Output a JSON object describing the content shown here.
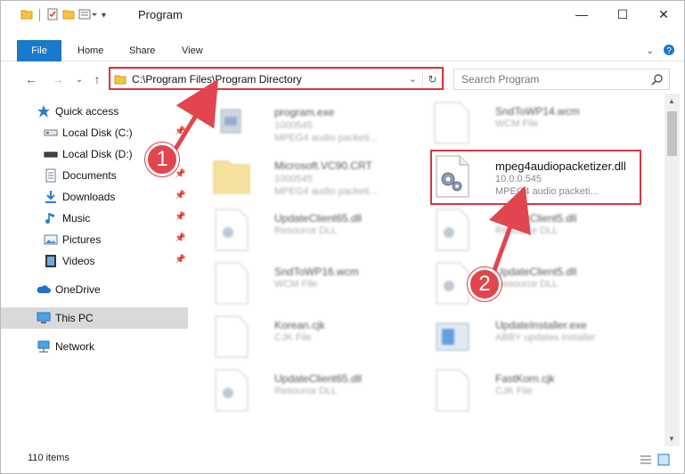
{
  "window": {
    "title": "Program",
    "controls": {
      "minimize": "—",
      "maximize": "☐",
      "close": "✕"
    }
  },
  "ribbon": {
    "file": "File",
    "tabs": [
      "Home",
      "Share",
      "View"
    ]
  },
  "address": {
    "path": "C:\\Program Files\\Program Directory",
    "search_placeholder": "Search Program"
  },
  "nav": {
    "items": [
      {
        "label": "Quick access",
        "icon": "star-icon"
      },
      {
        "label": "Local Disk (C:)",
        "icon": "drive-icon"
      },
      {
        "label": "Local Disk (D:)",
        "icon": "drive-icon"
      },
      {
        "label": "Documents",
        "icon": "documents-icon"
      },
      {
        "label": "Downloads",
        "icon": "downloads-icon"
      },
      {
        "label": "Music",
        "icon": "music-icon"
      },
      {
        "label": "Pictures",
        "icon": "pictures-icon"
      },
      {
        "label": "Videos",
        "icon": "videos-icon"
      },
      {
        "label": "OneDrive",
        "icon": "cloud-icon"
      },
      {
        "label": "This PC",
        "icon": "computer-icon"
      },
      {
        "label": "Network",
        "icon": "network-icon"
      }
    ],
    "pin": "📌"
  },
  "files": [
    {
      "name": "program.exe",
      "line2": "1000545",
      "line3": "MPEG4 audio packeti..."
    },
    {
      "name": "SndToWP14.wcm",
      "line2": "WCM File",
      "line3": ""
    },
    {
      "name": "Microsoft.VC90.CRT",
      "line2": "1000545",
      "line3": "MPEG4 audio packeti..."
    },
    {
      "name": "mpeg4audiopacketizer.dll",
      "line2": "10.0.0.545",
      "line3": "MPEG4 audio packeti..."
    },
    {
      "name": "UpdateClient65.dll",
      "line2": "Resource DLL",
      "line3": ""
    },
    {
      "name": "UpdateClient5.dll",
      "line2": "Resource DLL",
      "line3": ""
    },
    {
      "name": "SndToWP16.wcm",
      "line2": "WCM File",
      "line3": ""
    },
    {
      "name": "UpdateClient5.dll",
      "line2": "Resource DLL",
      "line3": ""
    },
    {
      "name": "Korean.cjk",
      "line2": "CJK File",
      "line3": ""
    },
    {
      "name": "UpdateInstaller.exe",
      "line2": "ABBY updates installer",
      "line3": ""
    },
    {
      "name": "UpdateClient65.dll",
      "line2": "Resource DLL",
      "line3": ""
    },
    {
      "name": "FastKorn.cjk",
      "line2": "CJK File",
      "line3": ""
    }
  ],
  "status": {
    "count": "110 items"
  },
  "steps": {
    "one": "1",
    "two": "2"
  },
  "colors": {
    "accent": "#1979ca",
    "highlight": "#d9363e",
    "badge": "#e2454e"
  }
}
